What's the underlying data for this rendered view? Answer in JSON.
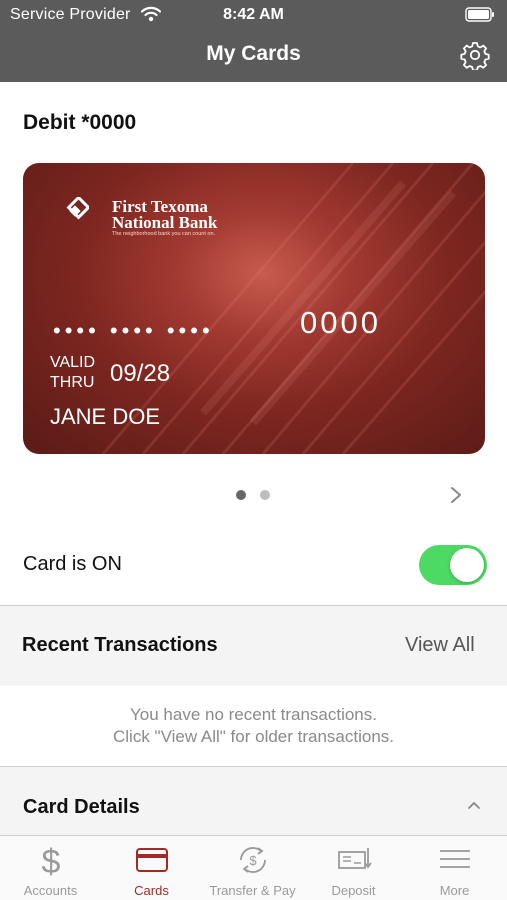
{
  "status_bar": {
    "carrier": "Service Provider",
    "time": "8:42 AM"
  },
  "header": {
    "title": "My Cards",
    "settings_icon": "gear-icon"
  },
  "card_section": {
    "card_name": "Debit *0000",
    "card": {
      "bank_name_line1": "First Texoma",
      "bank_name_line2": "National Bank",
      "bank_tagline": "The neighborhood bank you can count on.",
      "masked_digits": "•••• •••• ••••",
      "last_four": "0000",
      "valid_label_line1": "VALID",
      "valid_label_line2": "THRU",
      "expiry": "09/28",
      "holder": "JANE DOE",
      "color": "#7d2620"
    },
    "pager": {
      "total": 2,
      "active_index": 0
    },
    "status_label": "Card is ON",
    "card_enabled": true,
    "toggle_color": "#4cd964"
  },
  "transactions": {
    "title": "Recent Transactions",
    "view_all": "View All",
    "empty_line1": "You have no recent transactions.",
    "empty_line2": "Click \"View All\" for older transactions."
  },
  "card_details": {
    "title": "Card Details",
    "expanded": true
  },
  "tab_bar": {
    "active_color": "#a12a24",
    "tabs": [
      {
        "label": "Accounts",
        "icon": "dollar-icon",
        "active": false
      },
      {
        "label": "Cards",
        "icon": "card-icon",
        "active": true
      },
      {
        "label": "Transfer & Pay",
        "icon": "transfer-icon",
        "active": false
      },
      {
        "label": "Deposit",
        "icon": "check-deposit-icon",
        "active": false
      },
      {
        "label": "More",
        "icon": "menu-icon",
        "active": false
      }
    ]
  }
}
